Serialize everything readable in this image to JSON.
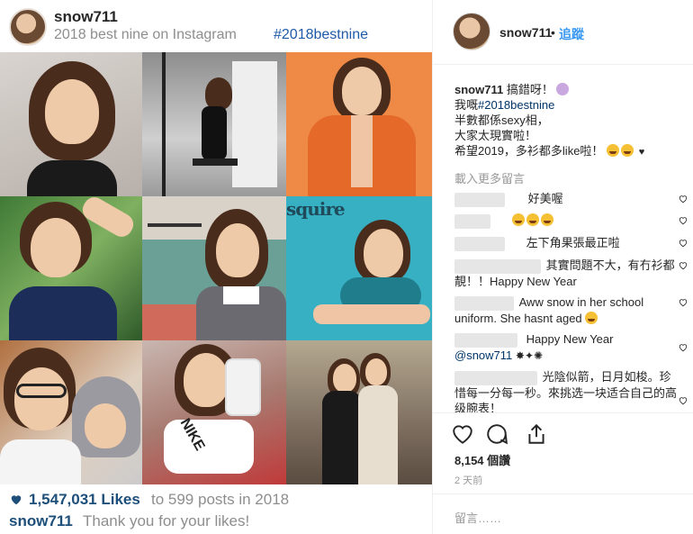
{
  "bestnine": {
    "username": "snow711",
    "subtitle": "2018 best nine on Instagram",
    "hashtag": "#2018bestnine",
    "magazine_text": "squire",
    "likes_count": "1,547,031 Likes",
    "likes_suffix": "to 599 posts in 2018",
    "footer_user": "snow711",
    "footer_text": "Thank you for your likes!"
  },
  "post": {
    "username": "snow711",
    "separator": "•",
    "follow_label": "追蹤",
    "caption": {
      "user": "snow711",
      "line1": "搞錯呀！",
      "line2_prefix": "我嘅",
      "hashtag": "#2018bestnine",
      "line3": "半數都係sexy相，",
      "line4": "大家太現實啦！",
      "line5": "希望2019，多衫都多like啦！"
    },
    "load_more": "載入更多留言",
    "comments": [
      {
        "text": "好美喔"
      },
      {
        "text": ""
      },
      {
        "text": "左下角果張最正啦"
      },
      {
        "text": "其實問題不大，有冇衫都靚！！Happy New Year"
      },
      {
        "text": "Aww snow in her school uniform. She hasnt aged"
      },
      {
        "text": "Happy New Year"
      },
      {
        "text": "@snow711"
      },
      {
        "text": "光陰似箭，日月如梭。珍惜每一分每一秒。來挑选一块适合自己的高级腕表！"
      }
    ],
    "views": "8,154 個讚",
    "time_ago": "2 天前",
    "add_comment_placeholder": "留言……"
  },
  "colors": {
    "link_blue": "#3897f0",
    "like_blue": "#1e4f7a",
    "muted": "#8e8e8e"
  },
  "icons": [
    "heart-icon",
    "comment-icon",
    "share-icon",
    "bookmark-icon"
  ]
}
